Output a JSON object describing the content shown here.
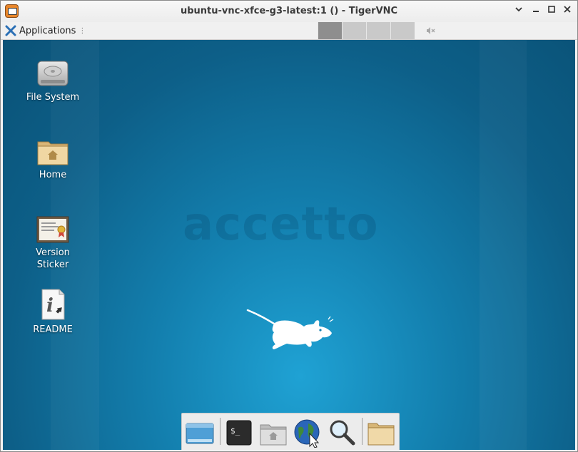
{
  "window": {
    "title": "ubuntu-vnc-xfce-g3-latest:1 () - TigerVNC",
    "controls": [
      "chevron-down-icon",
      "minimize-icon",
      "maximize-icon",
      "close-icon"
    ]
  },
  "panel": {
    "applications_label": "Applications",
    "separator_glyph": "⋮",
    "workspaces": [
      {
        "index": 1,
        "active": true
      },
      {
        "index": 2,
        "active": false
      },
      {
        "index": 3,
        "active": false
      },
      {
        "index": 4,
        "active": false
      }
    ],
    "volume_icon": "muted-speaker-icon"
  },
  "desktop": {
    "watermark": "accetto",
    "logo_icon": "xfce-mouse-icon",
    "icons": [
      {
        "label": "File System",
        "icon": "hard-drive-icon"
      },
      {
        "label": "Home",
        "icon": "home-folder-icon"
      },
      {
        "label": "Version\nSticker",
        "label_lines": [
          "Version",
          "Sticker"
        ],
        "icon": "certificate-icon"
      },
      {
        "label": "README",
        "icon": "info-document-icon"
      }
    ]
  },
  "dock": {
    "items": [
      {
        "name": "show-desktop",
        "icon": "desktop-icon"
      },
      {
        "name": "terminal",
        "icon": "terminal-icon",
        "glyph": "$_"
      },
      {
        "name": "file-manager",
        "icon": "home-folder-icon"
      },
      {
        "name": "web-browser",
        "icon": "globe-icon"
      },
      {
        "name": "app-finder",
        "icon": "magnifier-icon"
      },
      {
        "name": "folder",
        "icon": "folder-icon"
      }
    ]
  },
  "colors": {
    "desktop_center": "#1fa2d4",
    "desktop_edge": "#0a5277",
    "titlebar": "#f0f0f0",
    "panel": "#f0f0f0",
    "active_workspace": "#8e8e8e",
    "inactive_workspace": "#c9c9c9"
  }
}
